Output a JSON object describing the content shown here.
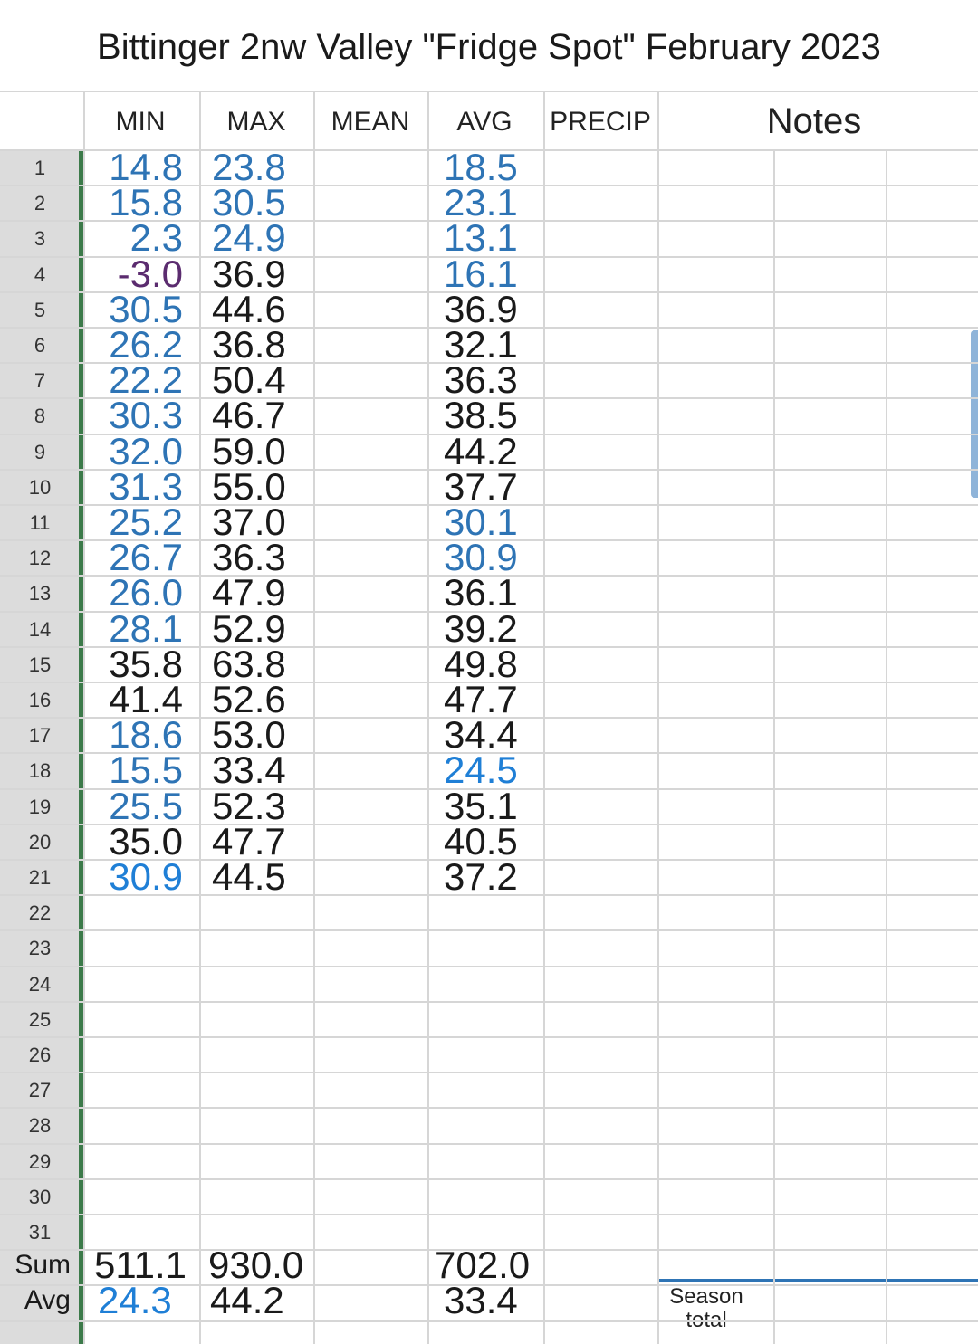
{
  "title": "Bittinger 2nw Valley \"Fridge Spot\" February 2023",
  "headers": {
    "min": "MIN",
    "max": "MAX",
    "mean": "MEAN",
    "avg": "AVG",
    "precip": "PRECIP",
    "notes": "Notes"
  },
  "row_numbers": [
    "1",
    "2",
    "3",
    "4",
    "5",
    "6",
    "7",
    "8",
    "9",
    "10",
    "11",
    "12",
    "13",
    "14",
    "15",
    "16",
    "17",
    "18",
    "19",
    "20",
    "21",
    "22",
    "23",
    "24",
    "25",
    "26",
    "27",
    "28",
    "29",
    "30",
    "31"
  ],
  "rows": [
    {
      "min": "14.8",
      "min_color": "blue",
      "max": "23.8",
      "max_color": "blue",
      "avg": "18.5",
      "avg_color": "blue"
    },
    {
      "min": "15.8",
      "min_color": "blue",
      "max": "30.5",
      "max_color": "blue",
      "avg": "23.1",
      "avg_color": "blue"
    },
    {
      "min": "2.3",
      "min_color": "blue",
      "max": "24.9",
      "max_color": "blue",
      "avg": "13.1",
      "avg_color": "blue"
    },
    {
      "min": "-3.0",
      "min_color": "purple",
      "max": "36.9",
      "max_color": "black",
      "avg": "16.1",
      "avg_color": "blue"
    },
    {
      "min": "30.5",
      "min_color": "blue",
      "max": "44.6",
      "max_color": "black",
      "avg": "36.9",
      "avg_color": "black"
    },
    {
      "min": "26.2",
      "min_color": "blue",
      "max": "36.8",
      "max_color": "black",
      "avg": "32.1",
      "avg_color": "black"
    },
    {
      "min": "22.2",
      "min_color": "blue",
      "max": "50.4",
      "max_color": "black",
      "avg": "36.3",
      "avg_color": "black"
    },
    {
      "min": "30.3",
      "min_color": "blue",
      "max": "46.7",
      "max_color": "black",
      "avg": "38.5",
      "avg_color": "black"
    },
    {
      "min": "32.0",
      "min_color": "blue",
      "max": "59.0",
      "max_color": "black",
      "avg": "44.2",
      "avg_color": "black"
    },
    {
      "min": "31.3",
      "min_color": "blue",
      "max": "55.0",
      "max_color": "black",
      "avg": "37.7",
      "avg_color": "black"
    },
    {
      "min": "25.2",
      "min_color": "blue",
      "max": "37.0",
      "max_color": "black",
      "avg": "30.1",
      "avg_color": "blue"
    },
    {
      "min": "26.7",
      "min_color": "blue",
      "max": "36.3",
      "max_color": "black",
      "avg": "30.9",
      "avg_color": "blue"
    },
    {
      "min": "26.0",
      "min_color": "blue",
      "max": "47.9",
      "max_color": "black",
      "avg": "36.1",
      "avg_color": "black"
    },
    {
      "min": "28.1",
      "min_color": "blue",
      "max": "52.9",
      "max_color": "black",
      "avg": "39.2",
      "avg_color": "black"
    },
    {
      "min": "35.8",
      "min_color": "black",
      "max": "63.8",
      "max_color": "black",
      "avg": "49.8",
      "avg_color": "black"
    },
    {
      "min": "41.4",
      "min_color": "black",
      "max": "52.6",
      "max_color": "black",
      "avg": "47.7",
      "avg_color": "black"
    },
    {
      "min": "18.6",
      "min_color": "blue",
      "max": "53.0",
      "max_color": "black",
      "avg": "34.4",
      "avg_color": "black"
    },
    {
      "min": "15.5",
      "min_color": "blue",
      "max": "33.4",
      "max_color": "black",
      "avg": "24.5",
      "avg_color": "bright"
    },
    {
      "min": "25.5",
      "min_color": "blue",
      "max": "52.3",
      "max_color": "black",
      "avg": "35.1",
      "avg_color": "black"
    },
    {
      "min": "35.0",
      "min_color": "black",
      "max": "47.7",
      "max_color": "black",
      "avg": "40.5",
      "avg_color": "black"
    },
    {
      "min": "30.9",
      "min_color": "bright",
      "max": "44.5",
      "max_color": "black",
      "avg": "37.2",
      "avg_color": "black"
    }
  ],
  "sum": {
    "label": "Sum",
    "min": "511.1",
    "max": "930.0",
    "avg": "702.0"
  },
  "average": {
    "label": "Avg",
    "min": "24.3",
    "max": "44.2",
    "avg": "33.4"
  },
  "season_total": {
    "line1": "Season",
    "line2": "total"
  },
  "colors": {
    "blue": "#2e74b5",
    "bright": "#1f7fd6",
    "black": "#1a1a1a",
    "purple": "#5b2c6f",
    "row_header_bg": "#dcdcdc",
    "frozen_bar": "#3c7a4a"
  }
}
